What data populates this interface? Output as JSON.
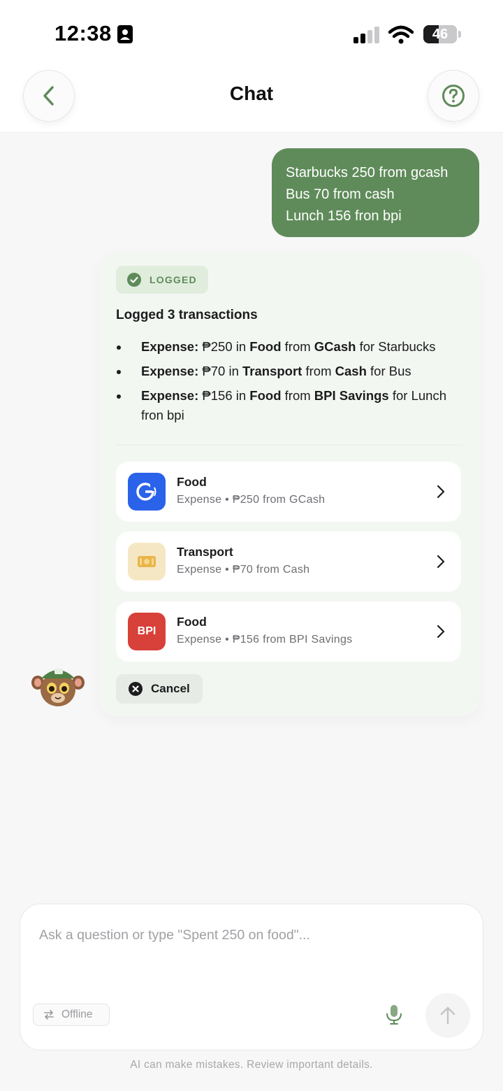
{
  "status_bar": {
    "time": "12:38",
    "battery_level": "46",
    "battery_fraction": 0.46
  },
  "header": {
    "title": "Chat",
    "back_icon": "chevron-left-icon",
    "help_icon": "question-circle-icon"
  },
  "user_message": {
    "lines": [
      "Starbucks 250 from gcash",
      "Bus 70 from cash",
      "Lunch 156 fron bpi"
    ]
  },
  "bot_message": {
    "badge": "LOGGED",
    "heading": "Logged 3 transactions",
    "bullets": [
      {
        "type": "Expense:",
        "amount": "₱250 in",
        "category": "Food",
        "from": "from",
        "account": "GCash",
        "for_text": "for Starbucks"
      },
      {
        "type": "Expense:",
        "amount": "₱70 in",
        "category": "Transport",
        "from": "from",
        "account": "Cash",
        "for_text": "for Bus"
      },
      {
        "type": "Expense:",
        "amount": "₱156 in",
        "category": "Food",
        "from": "from",
        "account": "BPI Savings",
        "for_text": "for Lunch fron bpi"
      }
    ],
    "transactions": [
      {
        "title": "Food",
        "subtitle": "Expense • ₱250 from GCash",
        "icon": "gcash-icon",
        "icon_text": "G",
        "icon_color": "#2a62ea"
      },
      {
        "title": "Transport",
        "subtitle": "Expense • ₱70 from Cash",
        "icon": "cash-icon",
        "icon_color": "#f6e7c4"
      },
      {
        "title": "Food",
        "subtitle": "Expense • ₱156 from BPI Savings",
        "icon": "bpi-icon",
        "icon_text": "BPI",
        "icon_color": "#d8403a"
      }
    ],
    "cancel_label": "Cancel"
  },
  "composer": {
    "placeholder": "Ask a question or type \"Spent 250 on food\"...",
    "offline_label": "Offline",
    "mic_icon": "microphone-icon",
    "send_icon": "arrow-up-icon"
  },
  "disclaimer": "AI can make mistakes. Review important details.",
  "colors": {
    "accent": "#5f8b5a",
    "badge_bg": "#e0eddd",
    "card_bg": "#f3f7f2"
  }
}
